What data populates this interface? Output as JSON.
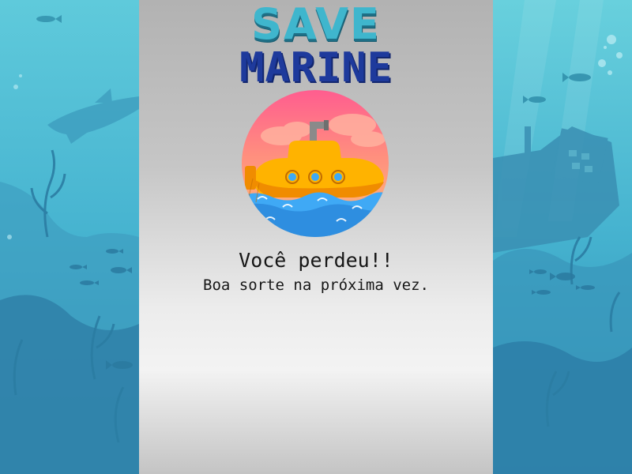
{
  "game": {
    "title_line1": "SAVE",
    "title_line2": "MARINE",
    "message": "Você perdeu!!",
    "submessage": "Boa sorte na próxima vez."
  },
  "icons": {
    "badge": "submarine-icon",
    "background": "underwater-scene"
  },
  "colors": {
    "ocean_light": "#5fcadb",
    "ocean_dark": "#2f8fb3",
    "title_save": "#3fb6cd",
    "title_marine": "#1e3a9c",
    "submarine": "#ffb300",
    "sunset_top": "#ff5d8f",
    "sunset_bottom": "#ffb07a",
    "sea": "#3fa9f5"
  }
}
